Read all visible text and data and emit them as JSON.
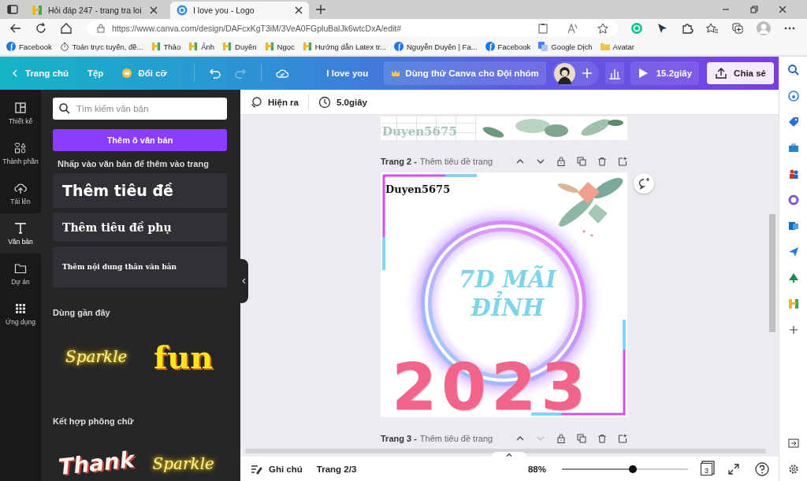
{
  "browser": {
    "tabs": [
      {
        "title": "Hỏi đáp 247 - trang tra loi",
        "selected": false,
        "kind": "hoidap"
      },
      {
        "title": "I love you - Logo",
        "selected": true,
        "kind": "canva"
      }
    ],
    "url": "https://www.canva.com/design/DAFcxKgT3iM/3VeA0FGpluBalJk6wtcDxA/edit#",
    "bookmarks": [
      {
        "label": "Facebook",
        "kind": "facebook"
      },
      {
        "label": "Toán trực tuyến, đề...",
        "kind": "timer"
      },
      {
        "label": "Thảo",
        "kind": "hoidap"
      },
      {
        "label": "Ảnh",
        "kind": "hoidap"
      },
      {
        "label": "Duyên",
        "kind": "hoidap"
      },
      {
        "label": "Ngọc",
        "kind": "hoidap"
      },
      {
        "label": "Hướng dẫn Latex tr...",
        "kind": "hoidap"
      },
      {
        "label": "Nguyễn Duyên | Fa...",
        "kind": "facebook"
      },
      {
        "label": "Facebook",
        "kind": "facebook"
      },
      {
        "label": "Google Dịch",
        "kind": "translate"
      },
      {
        "label": "Avatar",
        "kind": "folder"
      }
    ]
  },
  "header": {
    "back": "Trang chủ",
    "file": "Tệp",
    "resize": "Đổi cỡ",
    "redo_disabled": true,
    "title": "I love you",
    "trial": "Dùng thử Canva cho Đội nhóm",
    "duration": "15.2giây",
    "share": "Chia sẻ"
  },
  "rail": [
    {
      "label": "Thiết kế",
      "selected": false
    },
    {
      "label": "Thành phần",
      "selected": false
    },
    {
      "label": "Tải lên",
      "selected": false
    },
    {
      "label": "Văn bản",
      "selected": true
    },
    {
      "label": "Dự án",
      "selected": false
    },
    {
      "label": "Ứng dụng",
      "selected": false
    }
  ],
  "panel": {
    "search_placeholder": "Tìm kiếm văn bản",
    "add_button": "Thêm ô văn bản",
    "hint": "Nhấp vào văn bản để thêm vào trang",
    "presets": [
      {
        "text": "Thêm tiêu đề",
        "kind": "heading"
      },
      {
        "text": "Thêm tiêu đề phụ",
        "kind": "subheading"
      },
      {
        "text": "Thêm nội dung thân văn bản",
        "kind": "body"
      }
    ],
    "recent_title": "Dùng gần đây",
    "recent": [
      {
        "text": "Sparkle",
        "kind": "neon"
      },
      {
        "text": "fun",
        "kind": "bold"
      }
    ],
    "combos_title": "Kết hợp phông chữ",
    "combos": [
      {
        "text": "Thank",
        "kind": "retro"
      },
      {
        "text": "Sparkle",
        "kind": "neon"
      }
    ]
  },
  "toolbar": {
    "animation": "Hiện ra",
    "timing": "5.0giây"
  },
  "previous_page": {
    "signature": "Duyen5675"
  },
  "pages": [
    {
      "label": "Trang 2 -",
      "title_placeholder": "Thêm tiêu đề trang",
      "down_disabled": false
    },
    {
      "label": "Trang 3 -",
      "title_placeholder": "Thêm tiêu đề trang",
      "down_disabled": true
    }
  ],
  "design": {
    "signature": "Duyen5675",
    "headline": "7D MÃI ĐỈNH",
    "year": "2023"
  },
  "footer": {
    "notes": "Ghi chú",
    "page": "Trang 2/3",
    "zoom": "88%",
    "zoom_slider": {
      "level": 0.56
    },
    "page_count": "3"
  }
}
